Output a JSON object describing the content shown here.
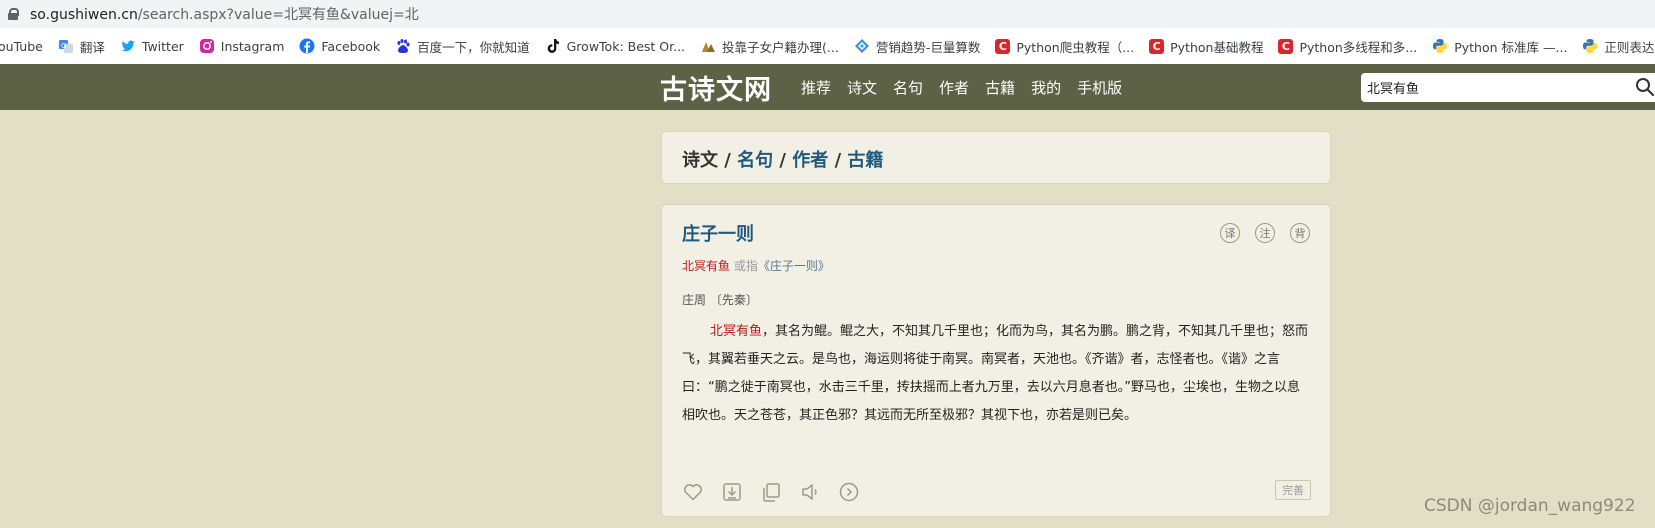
{
  "browser": {
    "url_host": "so.gushiwen.cn",
    "url_path": "/search.aspx?value=北冥有鱼&valuej=北"
  },
  "bookmarks": [
    {
      "label": "ouTube",
      "icon": "youtube-icon"
    },
    {
      "label": "翻译",
      "icon": "translate-icon"
    },
    {
      "label": "Twitter",
      "icon": "twitter-icon"
    },
    {
      "label": "Instagram",
      "icon": "instagram-icon"
    },
    {
      "label": "Facebook",
      "icon": "facebook-icon"
    },
    {
      "label": "百度一下，你就知道",
      "icon": "baidu-icon"
    },
    {
      "label": "GrowTok: Best Or...",
      "icon": "tiktok-icon"
    },
    {
      "label": "投靠子女户籍办理(...",
      "icon": "bookmark-icon"
    },
    {
      "label": "营销趋势-巨量算数",
      "icon": "bookmark-icon"
    },
    {
      "label": "Python爬虫教程（...",
      "icon": "csdn-icon",
      "glyph": "C"
    },
    {
      "label": "Python基础教程",
      "icon": "csdn-icon",
      "glyph": "C"
    },
    {
      "label": "Python多线程和多...",
      "icon": "csdn-icon",
      "glyph": "C"
    },
    {
      "label": "Python 标准库 —...",
      "icon": "python-icon"
    },
    {
      "label": "正则表达式H",
      "icon": "python-icon"
    }
  ],
  "nav": {
    "logo": "古诗文网",
    "menu": [
      "推荐",
      "诗文",
      "名句",
      "作者",
      "古籍",
      "我的",
      "手机版"
    ],
    "search_value": "北冥有鱼"
  },
  "tabs": {
    "items": [
      "诗文",
      "名句",
      "作者",
      "古籍"
    ],
    "separator": "/"
  },
  "result": {
    "title": "庄子一则",
    "actions": [
      "译",
      "注",
      "背"
    ],
    "ref_keyword": "北冥有鱼",
    "ref_middle": " 或指",
    "ref_book": "《庄子一则》",
    "author": "庄周 〔先秦〕",
    "body_keyword": "北冥有鱼",
    "body_text": "，其名为鲲。鲲之大，不知其几千里也；化而为鸟，其名为鹏。鹏之背，不知其几千里也；怒而飞，其翼若垂天之云。是鸟也，海运则将徙于南冥。南冥者，天池也。《齐谐》者，志怪者也。《谐》之言曰：“鹏之徙于南冥也，水击三千里，抟扶摇而上者九万里，去以六月息者也。”野马也，尘埃也，生物之以息相吹也。天之苍苍，其正色邪？其远而无所至极邪？其视下也，亦若是则已矣。",
    "tools": [
      "heart-icon",
      "download-icon",
      "copy-icon",
      "speaker-icon",
      "more-icon"
    ],
    "complete_label": "完善"
  },
  "watermark": "CSDN @jordan_wang922",
  "colors": {
    "page_bg": "#e1dfc5",
    "nav_bg": "#5d6146",
    "card_bg": "#f2f0e5",
    "link": "#1f5a7d",
    "keyword": "#b81a1a"
  }
}
